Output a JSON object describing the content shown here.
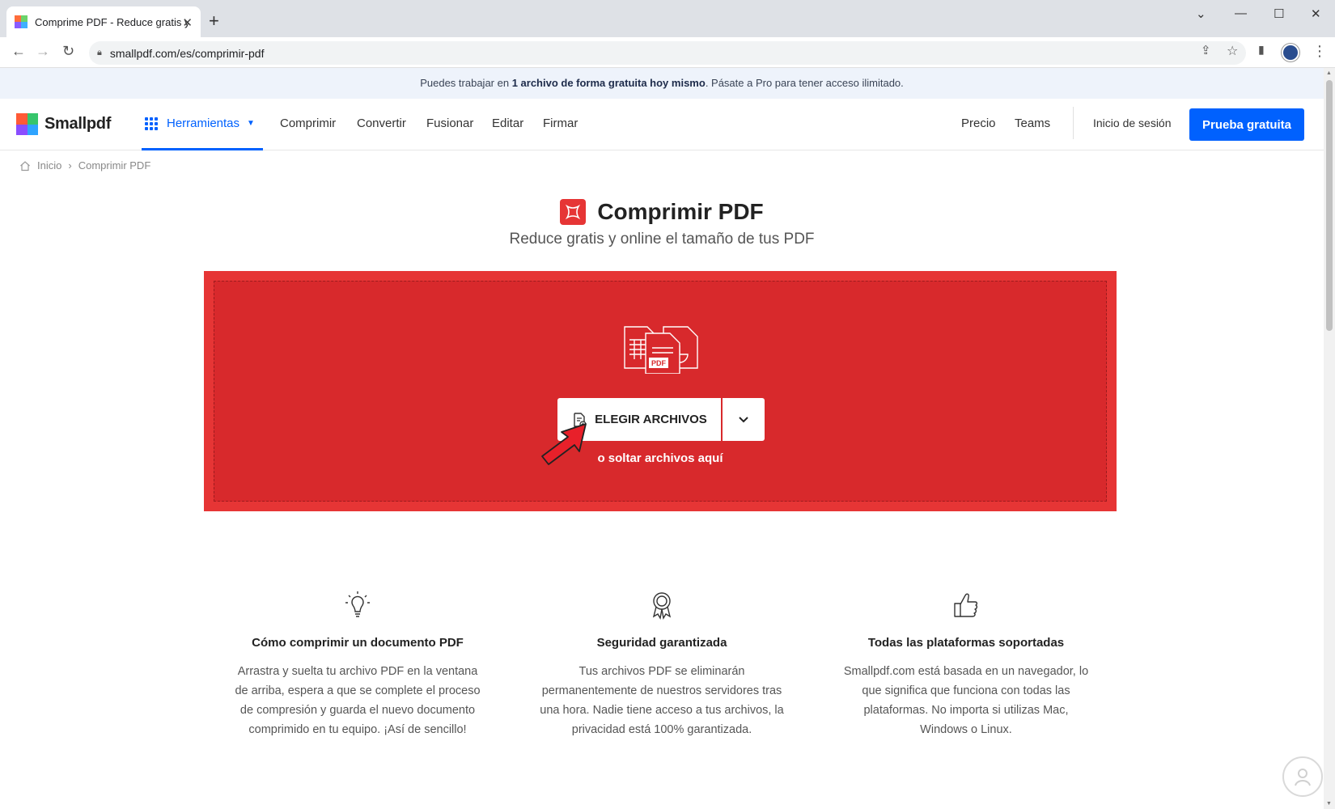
{
  "browser": {
    "tab_title": "Comprime PDF - Reduce gratis y",
    "tab_close": "✕",
    "new_tab": "+",
    "url": "smallpdf.com/es/comprimir-pdf",
    "window_controls": [
      "⌄",
      "—",
      "☐",
      "✕"
    ]
  },
  "banner": {
    "prefix": "Puedes trabajar en ",
    "highlight": "1 archivo de forma gratuita hoy mismo",
    "suffix": ". Pásate a Pro para tener acceso ilimitado."
  },
  "nav": {
    "logo": "Smallpdf",
    "tools_label": "Herramientas",
    "links": [
      "Comprimir",
      "Convertir",
      "Fusionar",
      "Editar",
      "Firmar"
    ],
    "right_links": [
      "Precio",
      "Teams"
    ],
    "login": "Inicio de sesión",
    "cta": "Prueba gratuita"
  },
  "breadcrumb": {
    "home": "Inicio",
    "separator": "›",
    "current": "Comprimir PDF"
  },
  "hero": {
    "title": "Comprimir PDF",
    "subtitle": "Reduce gratis y online el tamaño de tus PDF"
  },
  "dropzone": {
    "button_label": "ELEGIR ARCHIVOS",
    "drop_text": "o soltar archivos aquí",
    "illus_label": "PDF"
  },
  "features": [
    {
      "icon": "lightbulb-icon",
      "title": "Cómo comprimir un documento PDF",
      "text": "Arrastra y suelta tu archivo PDF en la ventana de arriba, espera a que se complete el proceso de compresión y guarda el nuevo documento comprimido en tu equipo. ¡Así de sencillo!"
    },
    {
      "icon": "award-ribbon-icon",
      "title": "Seguridad garantizada",
      "text": "Tus archivos PDF se eliminarán permanentemente de nuestros servidores tras una hora. Nadie tiene acceso a tus archivos, la privacidad está 100% garantizada."
    },
    {
      "icon": "thumbs-up-icon",
      "title": "Todas las plataformas soportadas",
      "text": "Smallpdf.com está basada en un navegador, lo que significa que funciona con todas las plataformas. No importa si utilizas Mac, Windows o Linux."
    }
  ],
  "colors": {
    "brand_blue": "#0061fe",
    "tool_red": "#e63535",
    "dropzone_inner": "#d8292c"
  }
}
